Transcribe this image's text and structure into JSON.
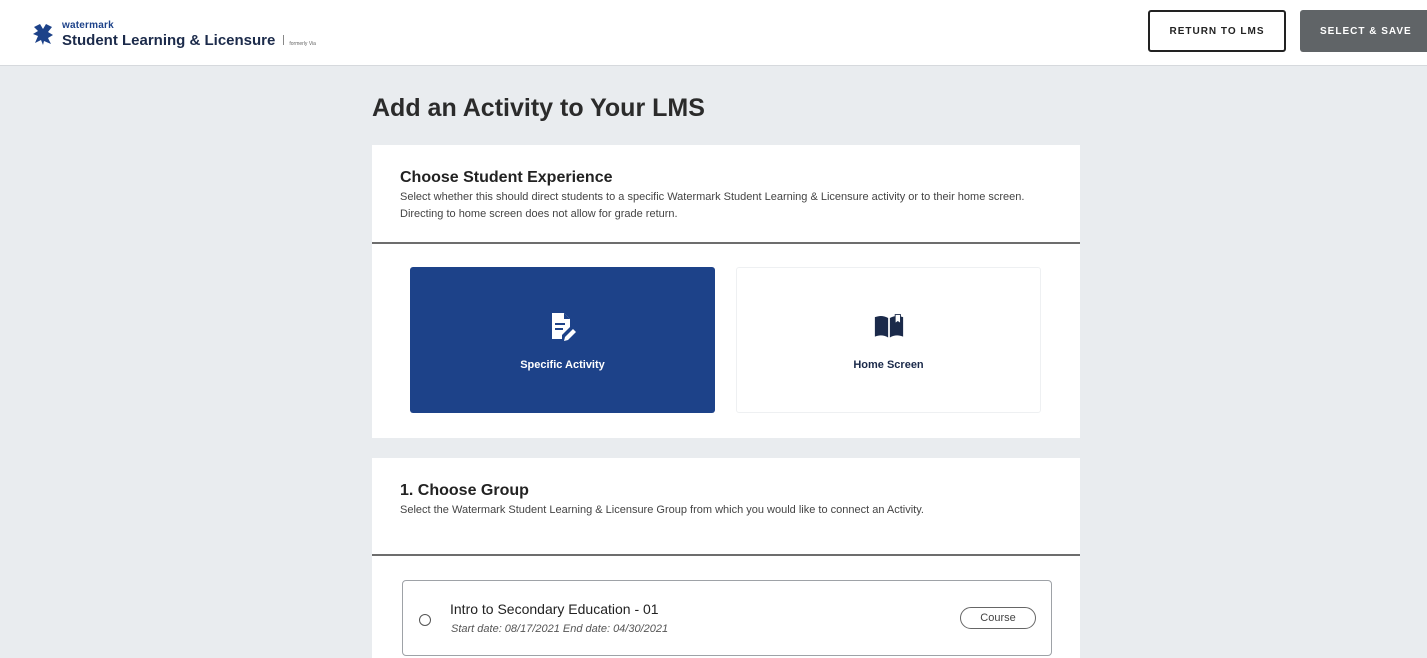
{
  "header": {
    "brand_small": "watermark",
    "brand_title": "Student Learning & Licensure",
    "brand_formerly": "formerly Via",
    "return_label": "RETURN TO LMS",
    "select_label": "SELECT & SAVE"
  },
  "page": {
    "title": "Add an Activity to Your LMS"
  },
  "experience": {
    "title": "Choose Student Experience",
    "description": "Select whether this should direct students to a specific Watermark Student Learning & Licensure activity or to their home screen. Directing to home screen does not allow for grade return.",
    "options": [
      {
        "label": "Specific Activity",
        "icon": "document-edit-icon",
        "selected": true
      },
      {
        "label": "Home Screen",
        "icon": "open-book-icon",
        "selected": false
      }
    ]
  },
  "group": {
    "title": "1. Choose Group",
    "description": "Select the Watermark Student Learning & Licensure Group from which you would like to connect an Activity.",
    "items": [
      {
        "name": "Intro to Secondary Education - 01",
        "dates": "Start date: 08/17/2021  End date: 04/30/2021",
        "badge": "Course"
      }
    ]
  },
  "colors": {
    "accent": "#1d4289",
    "select_button": "#606467",
    "background": "#e9ecef"
  }
}
